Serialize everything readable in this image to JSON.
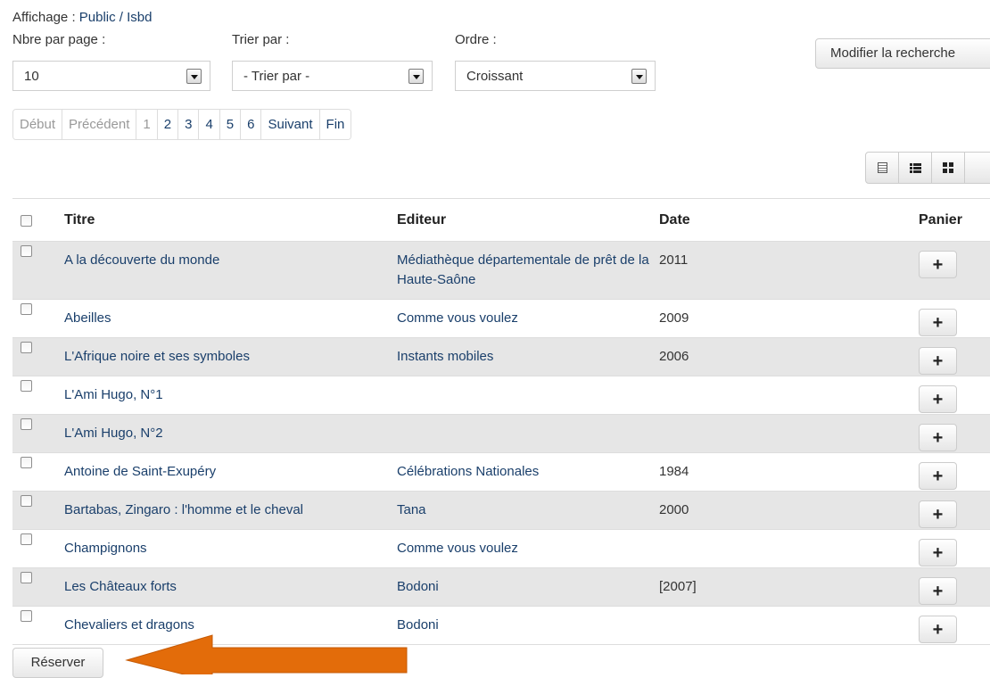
{
  "header": {
    "display_label": "Affichage :",
    "display_path": "Public / Isbd"
  },
  "controls": {
    "per_page_label": "Nbre par page :",
    "per_page_value": "10",
    "sort_label": "Trier par :",
    "sort_value": "- Trier par -",
    "order_label": "Ordre :",
    "order_value": "Croissant",
    "modify_search": "Modifier la recherche"
  },
  "pagination": {
    "first": "Début",
    "previous": "Précédent",
    "pages": [
      "1",
      "2",
      "3",
      "4",
      "5",
      "6"
    ],
    "current_page": "1",
    "next": "Suivant",
    "last": "Fin"
  },
  "view_buttons": [
    "document-view-icon",
    "list-view-icon",
    "grid-view-icon"
  ],
  "table": {
    "headers": {
      "title": "Titre",
      "publisher": "Editeur",
      "date": "Date",
      "basket": "Panier"
    },
    "rows": [
      {
        "title": "A la découverte du monde",
        "publisher": "Médiathèque départementale de prêt de la Haute-Saône",
        "date": "2011"
      },
      {
        "title": "Abeilles",
        "publisher": "Comme vous voulez",
        "date": "2009"
      },
      {
        "title": "L'Afrique noire et ses symboles",
        "publisher": "Instants mobiles",
        "date": "2006"
      },
      {
        "title": "L'Ami Hugo, N°1",
        "publisher": "",
        "date": ""
      },
      {
        "title": "L'Ami Hugo, N°2",
        "publisher": "",
        "date": ""
      },
      {
        "title": "Antoine de Saint-Exupéry",
        "publisher": "Célébrations Nationales",
        "date": "1984"
      },
      {
        "title": "Bartabas, Zingaro : l'homme et le cheval",
        "publisher": "Tana",
        "date": "2000"
      },
      {
        "title": "Champignons",
        "publisher": "Comme vous voulez",
        "date": ""
      },
      {
        "title": "Les Châteaux forts",
        "publisher": "Bodoni",
        "date": "[2007]"
      },
      {
        "title": "Chevaliers et dragons",
        "publisher": "Bodoni",
        "date": ""
      }
    ],
    "add_symbol": "+"
  },
  "actions": {
    "reserve": "Réserver"
  },
  "colors": {
    "link": "#1a3f6b",
    "row_stripe": "#e6e6e6",
    "annotation_arrow": "#e36c0a"
  }
}
